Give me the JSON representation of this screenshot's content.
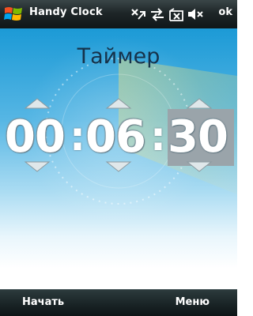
{
  "titlebar": {
    "app_title": "Handy Clock",
    "ok_label": "ok",
    "status_icons": [
      "connectivity-off-icon",
      "data-transfer-icon",
      "no-signal-icon",
      "speaker-muted-icon"
    ]
  },
  "main": {
    "title": "Таймер",
    "timer": {
      "hours": "00",
      "minutes": "06",
      "seconds": "30",
      "separator": ":",
      "selected_field": "seconds"
    }
  },
  "softkeys": {
    "left": "Начать",
    "right": "Меню"
  },
  "colors": {
    "titlebar": "#1e2628",
    "background_top": "#1c9ad6",
    "selected_field": "#9aa4aa",
    "title_text": "#16324a"
  }
}
